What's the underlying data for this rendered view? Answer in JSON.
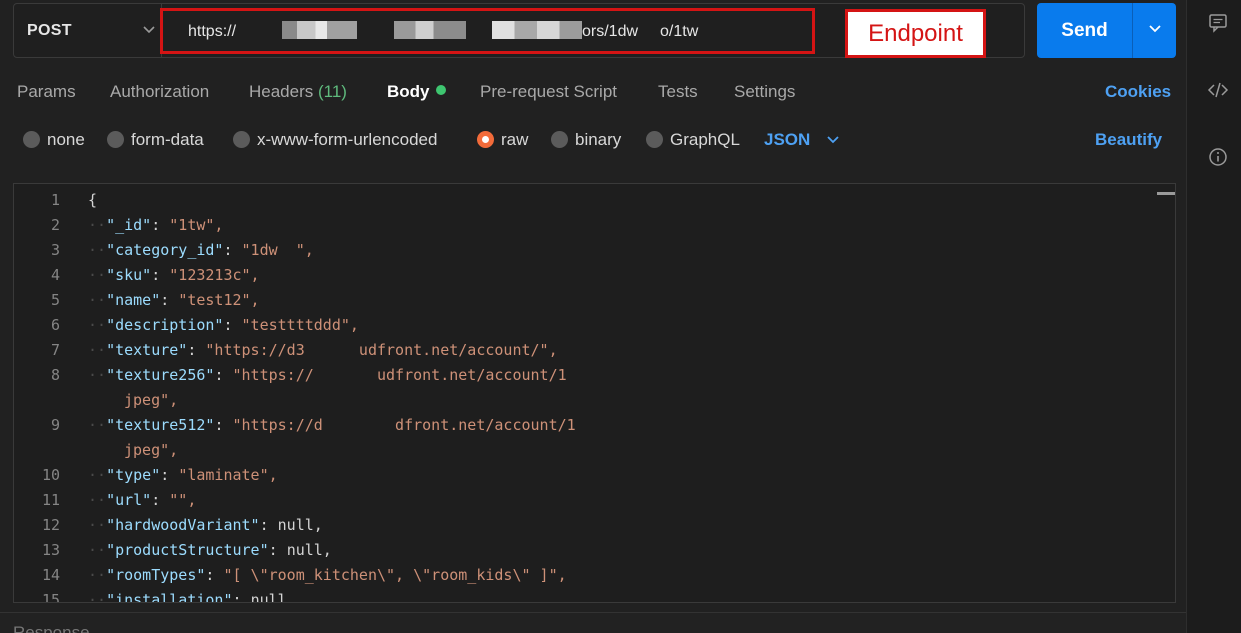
{
  "request": {
    "method": "POST",
    "url_visible": "https://",
    "url_tail_a": "ors/1dw",
    "url_tail_b": "o/1tw"
  },
  "annotation": {
    "label": "Endpoint",
    "color": "#d41414"
  },
  "send_label": "Send",
  "tabs": [
    {
      "label": "Params"
    },
    {
      "label": "Authorization"
    },
    {
      "label": "Headers",
      "count": "(11)"
    },
    {
      "label": "Body"
    },
    {
      "label": "Pre-request Script"
    },
    {
      "label": "Tests"
    },
    {
      "label": "Settings"
    }
  ],
  "cookies_label": "Cookies",
  "body_modes": [
    "none",
    "form-data",
    "x-www-form-urlencoded",
    "raw",
    "binary",
    "GraphQL"
  ],
  "selected_mode": "raw",
  "format": "JSON",
  "beautify_label": "Beautify",
  "editor_lines": [
    {
      "n": "1",
      "key": "",
      "sep": "{",
      "val": "",
      "valType": "lit"
    },
    {
      "n": "2",
      "key": "\"_id\"",
      "sep": ": ",
      "val": "\"1tw\",",
      "valType": "str"
    },
    {
      "n": "3",
      "key": "\"category_id\"",
      "sep": ": ",
      "val": "\"1dw  \",",
      "valType": "str"
    },
    {
      "n": "4",
      "key": "\"sku\"",
      "sep": ": ",
      "val": "\"123213c\",",
      "valType": "str"
    },
    {
      "n": "5",
      "key": "\"name\"",
      "sep": ": ",
      "val": "\"test12\",",
      "valType": "str"
    },
    {
      "n": "6",
      "key": "\"description\"",
      "sep": ": ",
      "val": "\"testtttddd\",",
      "valType": "str"
    },
    {
      "n": "7",
      "key": "\"texture\"",
      "sep": ": ",
      "val": "\"https://d3      udfront.net/account/\",",
      "valType": "str"
    },
    {
      "n": "8",
      "key": "\"texture256\"",
      "sep": ": ",
      "val": "\"https://       udfront.net/account/1",
      "valType": "str"
    },
    {
      "n": "",
      "key": "",
      "sep": "",
      "val": "jpeg\",",
      "valType": "str",
      "wrap": true
    },
    {
      "n": "9",
      "key": "\"texture512\"",
      "sep": ": ",
      "val": "\"https://d        dfront.net/account/1",
      "valType": "str"
    },
    {
      "n": "",
      "key": "",
      "sep": "",
      "val": "jpeg\",",
      "valType": "str",
      "wrap": true
    },
    {
      "n": "10",
      "key": "\"type\"",
      "sep": ": ",
      "val": "\"laminate\",",
      "valType": "str"
    },
    {
      "n": "11",
      "key": "\"url\"",
      "sep": ": ",
      "val": "\"\",",
      "valType": "str"
    },
    {
      "n": "12",
      "key": "\"hardwoodVariant\"",
      "sep": ": ",
      "val": "null,",
      "valType": "lit"
    },
    {
      "n": "13",
      "key": "\"productStructure\"",
      "sep": ": ",
      "val": "null,",
      "valType": "lit"
    },
    {
      "n": "14",
      "key": "\"roomTypes\"",
      "sep": ": ",
      "val": "\"[ \\\"room_kitchen\\\", \\\"room_kids\\\" ]\",",
      "valType": "str"
    },
    {
      "n": "15",
      "key": "\"installation\"",
      "sep": ": ",
      "val": "null,",
      "valType": "lit"
    }
  ],
  "response_label": "Response"
}
